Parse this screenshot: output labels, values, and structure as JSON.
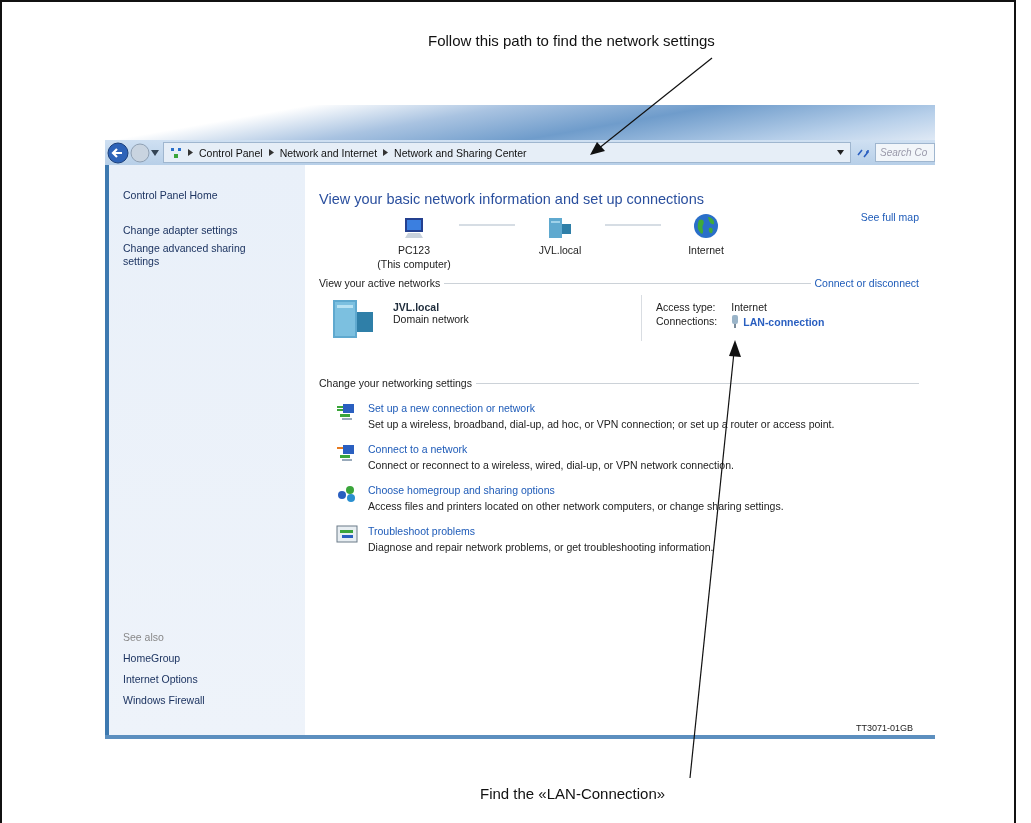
{
  "callouts": [
    {
      "text": "Follow this path to find the network settings"
    },
    {
      "text": "Find the «LAN-Connection»"
    }
  ],
  "address_bar": {
    "breadcrumbs": [
      "Control Panel",
      "Network and Internet",
      "Network and Sharing Center"
    ],
    "search_placeholder": "Search Co"
  },
  "sidebar": {
    "items": [
      "Control Panel Home",
      "Change adapter settings",
      "Change advanced sharing settings"
    ],
    "see_also_title": "See also",
    "see_also": [
      "HomeGroup",
      "Internet Options",
      "Windows Firewall"
    ]
  },
  "main": {
    "title": "View your basic network information and set up connections",
    "map": {
      "nodes": [
        {
          "kind": "computer",
          "label": "PC123",
          "sublabel": "(This computer)"
        },
        {
          "kind": "domain",
          "label": "JVL.local"
        },
        {
          "kind": "internet",
          "label": "Internet"
        }
      ],
      "link": "See full map"
    },
    "active_networks": {
      "heading": "View your active networks",
      "link": "Connect or disconnect",
      "network_name": "JVL.local",
      "network_type": "Domain network",
      "access_type_label": "Access type:",
      "access_type": "Internet",
      "connections_label": "Connections:",
      "connection": "LAN-connection"
    },
    "settings": {
      "heading": "Change your networking settings",
      "tasks": [
        {
          "kind": "setup",
          "title": "Set up a new connection or network",
          "description": "Set up a wireless, broadband, dial-up, ad hoc, or VPN connection; or set up a router or access point."
        },
        {
          "kind": "connect",
          "title": "Connect to a network",
          "description": "Connect or reconnect to a wireless, wired, dial-up, or VPN network connection."
        },
        {
          "kind": "homegroup",
          "title": "Choose homegroup and sharing options",
          "description": "Access files and printers located on other network computers, or change sharing settings."
        },
        {
          "kind": "troubleshoot",
          "title": "Troubleshoot problems",
          "description": "Diagnose and repair network problems, or get troubleshooting information."
        }
      ]
    }
  },
  "figure_id": "TT3071-01GB"
}
